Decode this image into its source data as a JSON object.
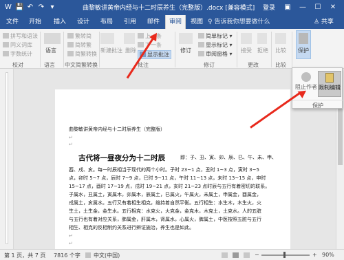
{
  "window": {
    "title": "曲黎敏讲黄帝内经与十二时辰养生（完整版）.docx [兼容模式] - Word",
    "login": "登录",
    "qa_save": "💾",
    "qa_undo": "↶",
    "qa_redo": "↷",
    "qa_custom": "▾",
    "win_ribbon_opts": "▣",
    "win_min": "—",
    "win_max": "☐",
    "win_close": "✕"
  },
  "tabs": [
    {
      "label": "文件"
    },
    {
      "label": "开始"
    },
    {
      "label": "插入"
    },
    {
      "label": "设计"
    },
    {
      "label": "布局"
    },
    {
      "label": "引用"
    },
    {
      "label": "邮件"
    },
    {
      "label": "审阅"
    },
    {
      "label": "视图"
    }
  ],
  "tellme": "♀ 告诉我你想要做什么",
  "share": "♙ 共享",
  "ribbon": {
    "proofing": {
      "items": [
        "拼写和语法",
        "同义词库",
        "字数统计"
      ],
      "label": "校对"
    },
    "language": {
      "item": "语言",
      "label": "语言"
    },
    "chinese_conversion": {
      "items": [
        "繁转简",
        "简转繁",
        "简繁转换"
      ],
      "label": "中文简繁转换"
    },
    "comments": {
      "items": [
        "新建批注",
        "删除",
        "上一条",
        "下一条",
        "显示批注"
      ],
      "label": "批注"
    },
    "tracking": {
      "items": [
        "修订",
        "简单标记",
        "显示标记",
        "审阅窗格"
      ],
      "label": "修订"
    },
    "changes": {
      "items": [
        "接受",
        "拒绝"
      ],
      "label": "更改"
    },
    "compare": {
      "item": "比较",
      "label": "比较"
    },
    "protect": {
      "item": "保护"
    }
  },
  "protect_popup": {
    "block_authors": "阻止作者",
    "restrict_editing": "限制编辑",
    "group_label": "保护"
  },
  "document": {
    "title_line": "曲黎敏讲黄帝内经与十二时辰养生（完整版）",
    "heading": "古代将一昼夜分为十二时辰",
    "heading_rest": "即：子、丑、寅、卯、辰、巳、午、未、申、",
    "lines": [
      "酉、戌、亥。每一时辰相当于现代的两个小时。子时 23~1 点，丑时 1~3 点，寅时 3~5",
      "点，卯时 5~7 点，辰时 7~9 点，巳时 9~11 点，午时 11~13 点，未时 13~15 点，申时",
      "15~17 点，酉时 17~19 点，戌时 19~21 点，亥时 21~23 点时辰与五行有着密切的联系。",
      "子属水，丑属土，寅属木，卯属木，辰属土，巳属火，午属火，未属土，申属金，酉属金，",
      "戌属土，亥属水。五行又有着相生相克，维持着自然平衡。五行相生：水生木，木生火，火",
      "生土，土生金，金生水。五行相克：水克火，火克金，金克木，木克土，土克水。人的五脏",
      "与五行也有着对应关系，肺属金，肝属木，肾属水，心属火，脾属土，中医按照五脏与五行",
      "相生、相克的反相制约关系进行辨证施治，养生也是如此。"
    ],
    "para_mark": "↵"
  },
  "status": {
    "page": "第 1 页，共 7 页",
    "words": "7816 个字",
    "lang": "中文(中国)",
    "zoom": "90%",
    "zoom_minus": "−",
    "zoom_plus": "+"
  }
}
